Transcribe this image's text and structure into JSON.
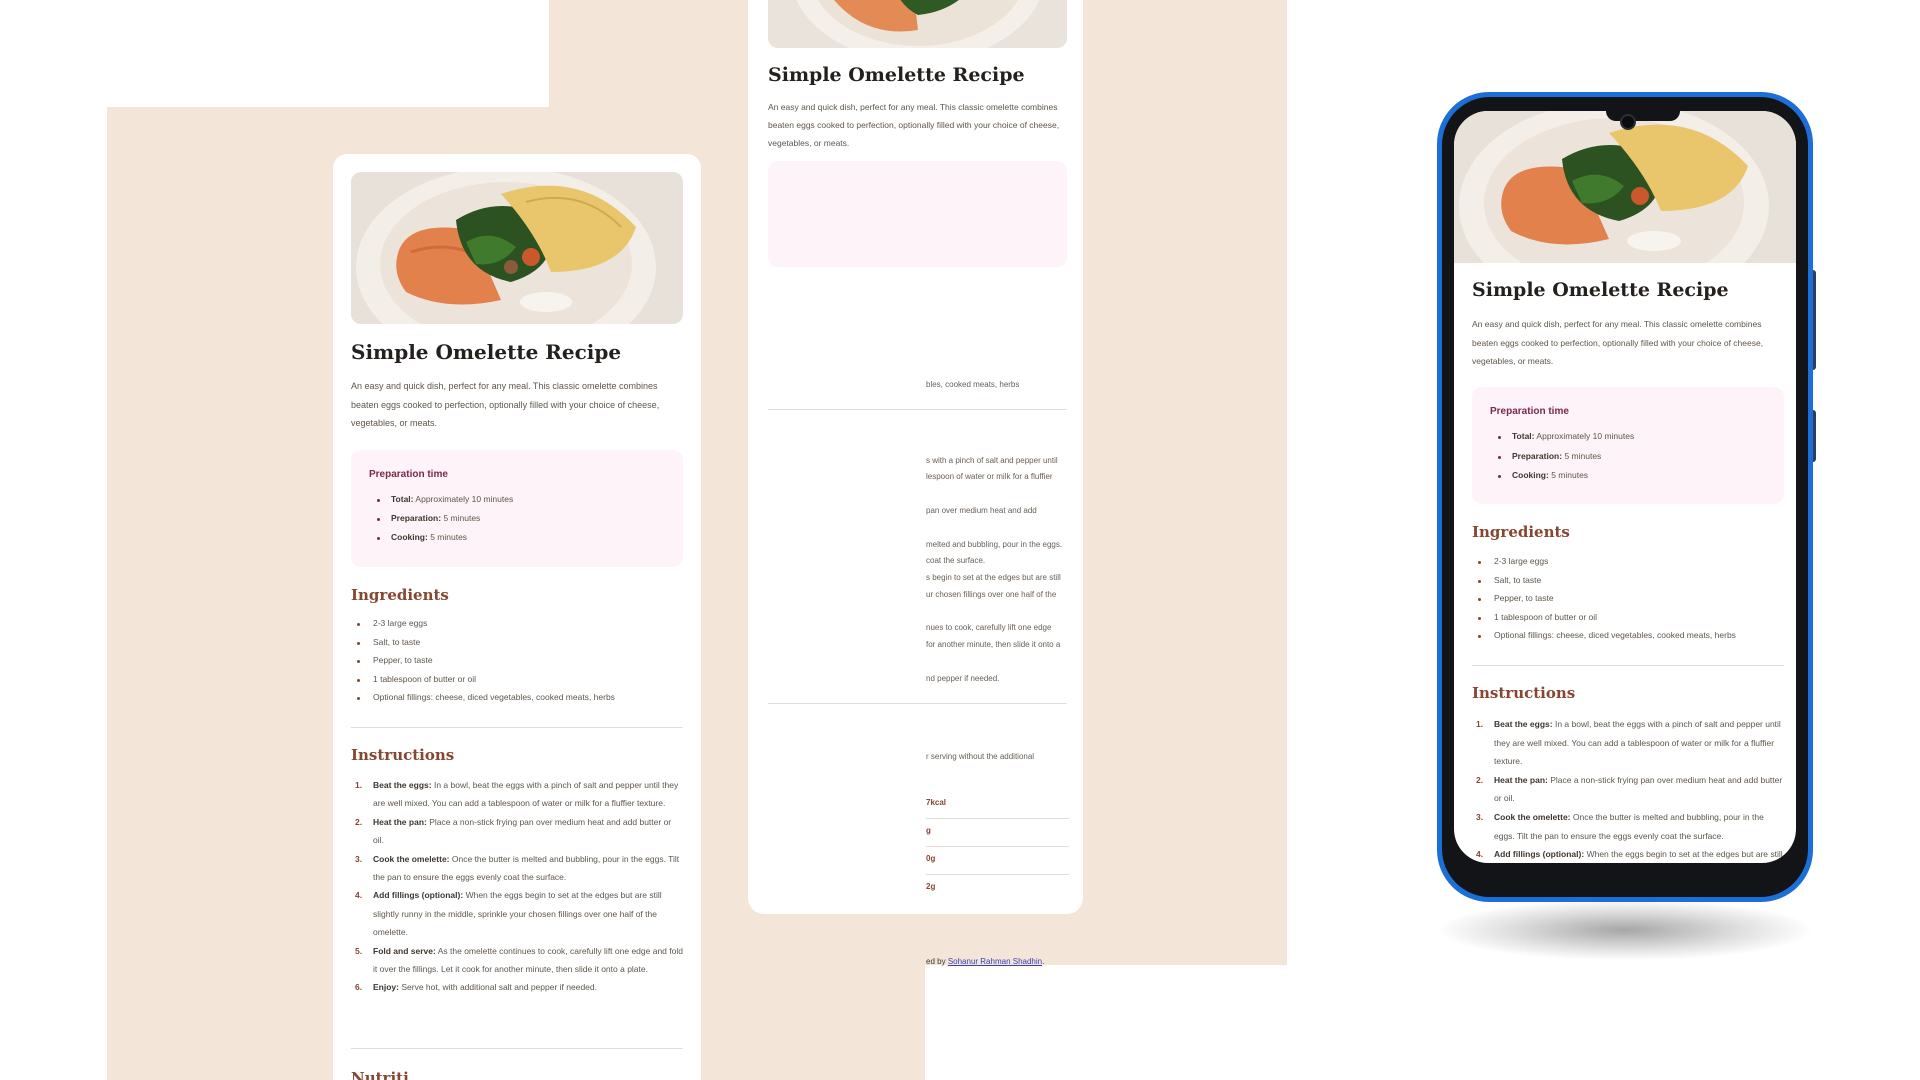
{
  "recipe": {
    "title": "Simple Omelette Recipe",
    "description": "An easy and quick dish, perfect for any meal. This classic omelette combines beaten eggs cooked to perfection, optionally filled with your choice of cheese, vegetables, or meats.",
    "prep": {
      "title": "Preparation time",
      "items": [
        {
          "label": "Total:",
          "value": "Approximately 10 minutes"
        },
        {
          "label": "Preparation:",
          "value": "5 minutes"
        },
        {
          "label": "Cooking:",
          "value": "5 minutes"
        }
      ]
    },
    "ingredients": {
      "title": "Ingredients",
      "items": [
        "2-3 large eggs",
        "Salt, to taste",
        "Pepper, to taste",
        "1 tablespoon of butter or oil",
        "Optional fillings: cheese, diced vegetables, cooked meats, herbs"
      ]
    },
    "instructions": {
      "title": "Instructions",
      "items": [
        {
          "num": "1.",
          "label": "Beat the eggs:",
          "text": "In a bowl, beat the eggs with a pinch of salt and pepper until they are well mixed. You can add a tablespoon of water or milk for a fluffier texture."
        },
        {
          "num": "2.",
          "label": "Heat the pan:",
          "text": "Place a non-stick frying pan over medium heat and add butter or oil."
        },
        {
          "num": "3.",
          "label": "Cook the omelette:",
          "text": "Once the butter is melted and bubbling, pour in the eggs. Tilt the pan to ensure the eggs evenly coat the surface."
        },
        {
          "num": "4.",
          "label": "Add fillings (optional):",
          "text": "When the eggs begin to set at the edges but are still slightly runny in the middle, sprinkle your chosen fillings over one half of the omelette."
        },
        {
          "num": "5.",
          "label": "Fold and serve:",
          "text": "As the omelette continues to cook, carefully lift one edge and fold it over the fillings. Let it cook for another minute, then slide it onto a plate."
        },
        {
          "num": "6.",
          "label": "Enjoy:",
          "text": "Serve hot, with additional salt and pepper if needed."
        }
      ]
    },
    "nutrition_title_partial": "Nutriti"
  },
  "middle_card_visible_fragments": {
    "ingredients_tail": "bles, cooked meats, herbs",
    "ins_lines": [
      "s with a pinch of salt and pepper until",
      "lespoon of water or milk for a fluffier",
      "pan over medium heat and add",
      "melted and bubbling, pour in the eggs.",
      "coat the surface.",
      "s begin to set at the edges but are still",
      "ur chosen fillings over one half of the",
      "nues to cook, carefully lift one edge",
      "for another minute, then slide it onto a",
      "nd pepper if needed."
    ],
    "nutrition_tail": "r serving without the additional",
    "nutrition_values": [
      "7kcal",
      "g",
      "0g",
      "2g"
    ],
    "footer_prefix": "ed by",
    "footer_link": "Sohanur Rahman Shadhin",
    "footer_end": "."
  },
  "colors": {
    "backdrop": "#f3e5d8",
    "card": "#ffffff",
    "heading": "#24201d",
    "accent_brown": "#854632",
    "accent_rose": "#7a284b",
    "prep_bg": "#fdf3f8",
    "phone_frame": "#1c6fd6"
  }
}
